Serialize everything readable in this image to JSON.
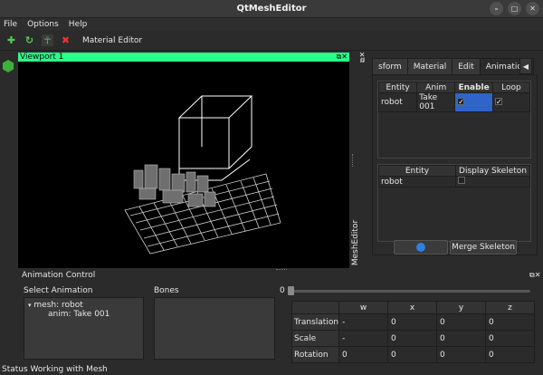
{
  "window": {
    "title": "QtMeshEditor"
  },
  "menu": [
    "File",
    "Options",
    "Help"
  ],
  "toolbar": {
    "material_editor": "Material Editor"
  },
  "viewport": {
    "title": "Viewport 1"
  },
  "dock": {
    "title": "MeshEditor",
    "tabs": [
      "sform",
      "Material",
      "Edit",
      "Animation"
    ],
    "active_tab": "Animation",
    "anim_table": {
      "headers": [
        "Entity",
        "Anim",
        "Enable",
        "Loop"
      ],
      "rows": [
        {
          "entity": "robot",
          "anim": "Take 001",
          "enable": "✓",
          "loop": "✓"
        }
      ]
    },
    "skeleton_table": {
      "headers": [
        "Entity",
        "Display Skeleton"
      ],
      "rows": [
        {
          "entity": "robot"
        }
      ]
    },
    "merge_button": "Merge Skeleton"
  },
  "animation_control": {
    "title": "Animation Control",
    "select_label": "Select Animation",
    "bones_label": "Bones",
    "tree": {
      "mesh": "mesh: robot",
      "anim": "anim: Take 001"
    },
    "slider_value": "0",
    "slider_fraction": 0,
    "transform": {
      "headers": [
        "w",
        "x",
        "y",
        "z"
      ],
      "rows": [
        {
          "label": "Translation",
          "values": [
            "-",
            "0",
            "0",
            "0"
          ]
        },
        {
          "label": "Scale",
          "values": [
            "-",
            "0",
            "0",
            "0"
          ]
        },
        {
          "label": "Rotation",
          "values": [
            "0",
            "0",
            "0",
            "0"
          ]
        }
      ]
    }
  },
  "status": "Status Working with Mesh",
  "icons": {
    "min": "minimize-icon",
    "max": "maximize-icon",
    "close": "close-icon",
    "add": "plus-icon",
    "reload": "refresh-icon",
    "skeleton": "figure-icon",
    "delete": "delete-icon"
  },
  "colors": {
    "viewport_header": "#2aff8a",
    "accent_green": "#3bb33b",
    "selection": "#2f65ca"
  }
}
